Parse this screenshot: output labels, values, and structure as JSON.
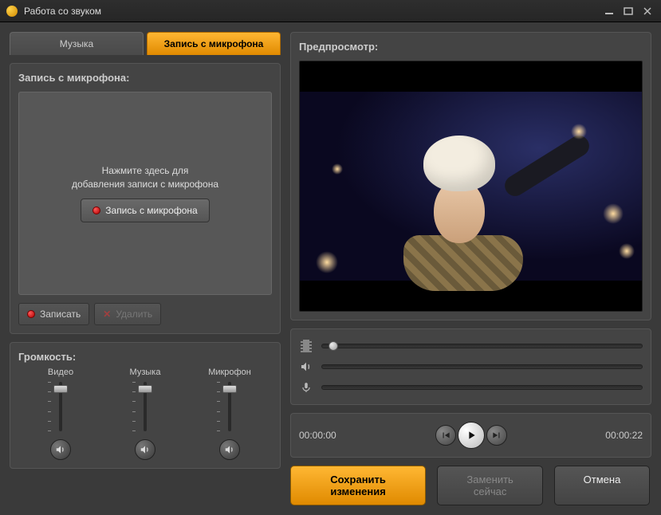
{
  "window": {
    "title": "Работа со звуком"
  },
  "tabs": {
    "music": "Музыка",
    "mic": "Запись с микрофона"
  },
  "rec": {
    "panel_title": "Запись с микрофона:",
    "hint_line1": "Нажмите здесь для",
    "hint_line2": "добавления записи с микрофона",
    "button": "Запись с микрофона",
    "record": "Записать",
    "delete": "Удалить"
  },
  "volume": {
    "title": "Громкость:",
    "video": "Видео",
    "music": "Музыка",
    "mic": "Микрофон"
  },
  "preview": {
    "title": "Предпросмотр:"
  },
  "time": {
    "current": "00:00:00",
    "total": "00:00:22"
  },
  "footer": {
    "save": "Сохранить изменения",
    "replace": "Заменить сейчас",
    "cancel": "Отмена"
  }
}
